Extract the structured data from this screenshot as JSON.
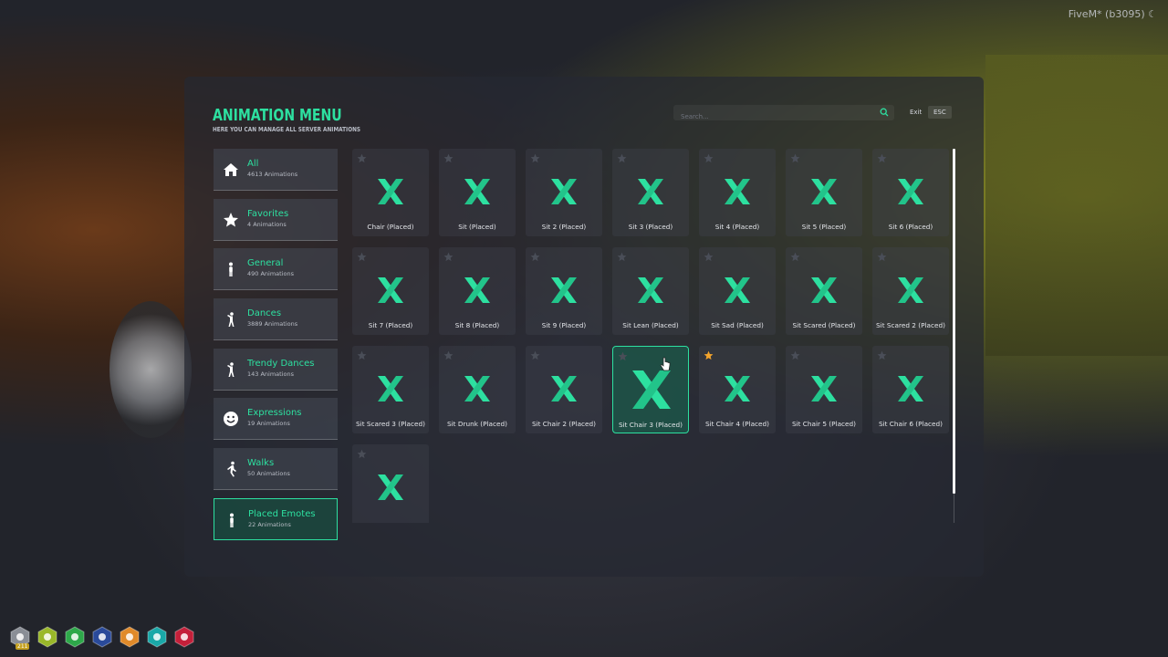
{
  "watermark": "FiveM* (b3095)",
  "header": {
    "title": "ANIMATION MENU",
    "subtitle": "HERE YOU CAN MANAGE ALL SERVER ANIMATIONS",
    "search_placeholder": "Search...",
    "exit_label": "Exit",
    "esc_label": "ESC"
  },
  "colors": {
    "accent": "#2de0a0",
    "favorite_star": "#f3a42c",
    "star_inactive": "#4a4e58"
  },
  "sidebar": {
    "items": [
      {
        "name": "All",
        "count": "4613 Animations",
        "icon": "home-icon"
      },
      {
        "name": "Favorites",
        "count": "4 Animations",
        "icon": "star-icon"
      },
      {
        "name": "General",
        "count": "490 Animations",
        "icon": "person-standing-icon"
      },
      {
        "name": "Dances",
        "count": "3889 Animations",
        "icon": "dancer-icon"
      },
      {
        "name": "Trendy Dances",
        "count": "143 Animations",
        "icon": "dancer-icon"
      },
      {
        "name": "Expressions",
        "count": "19 Animations",
        "icon": "smiley-face-icon"
      },
      {
        "name": "Walks",
        "count": "50 Animations",
        "icon": "walking-person-icon"
      },
      {
        "name": "Placed Emotes",
        "count": "22 Animations",
        "icon": "person-standing-icon",
        "active": true
      }
    ]
  },
  "animations": [
    {
      "label": "Chair (Placed)",
      "favorite": false
    },
    {
      "label": "Sit (Placed)",
      "favorite": false
    },
    {
      "label": "Sit 2 (Placed)",
      "favorite": false
    },
    {
      "label": "Sit 3 (Placed)",
      "favorite": false
    },
    {
      "label": "Sit 4 (Placed)",
      "favorite": false
    },
    {
      "label": "Sit 5 (Placed)",
      "favorite": false
    },
    {
      "label": "Sit 6 (Placed)",
      "favorite": false
    },
    {
      "label": "Sit 7 (Placed)",
      "favorite": false
    },
    {
      "label": "Sit 8 (Placed)",
      "favorite": false
    },
    {
      "label": "Sit 9 (Placed)",
      "favorite": false
    },
    {
      "label": "Sit Lean (Placed)",
      "favorite": false
    },
    {
      "label": "Sit Sad (Placed)",
      "favorite": false
    },
    {
      "label": "Sit Scared (Placed)",
      "favorite": false
    },
    {
      "label": "Sit Scared 2 (Placed)",
      "favorite": false
    },
    {
      "label": "Sit Scared 3 (Placed)",
      "favorite": false
    },
    {
      "label": "Sit Drunk (Placed)",
      "favorite": false
    },
    {
      "label": "Sit Chair 2 (Placed)",
      "favorite": false
    },
    {
      "label": "Sit Chair 3 (Placed)",
      "favorite": false,
      "selected": true
    },
    {
      "label": "Sit Chair 4 (Placed)",
      "favorite": true
    },
    {
      "label": "Sit Chair 5 (Placed)",
      "favorite": false
    },
    {
      "label": "Sit Chair 6 (Placed)",
      "favorite": false
    },
    {
      "label": "",
      "favorite": false
    }
  ],
  "hud": {
    "badge": "211",
    "icons": [
      {
        "icon": "id-card-icon",
        "color": "#8a8e96"
      },
      {
        "icon": "hunger-icon",
        "color": "#9ab82a"
      },
      {
        "icon": "health-heart-icon",
        "color": "#2ea84a"
      },
      {
        "icon": "armor-shield-icon",
        "color": "#2a4a9a"
      },
      {
        "icon": "food-icon",
        "color": "#e08a2a"
      },
      {
        "icon": "thirst-drop-icon",
        "color": "#1aa8a8"
      },
      {
        "icon": "stress-brain-icon",
        "color": "#c4203a"
      }
    ]
  }
}
